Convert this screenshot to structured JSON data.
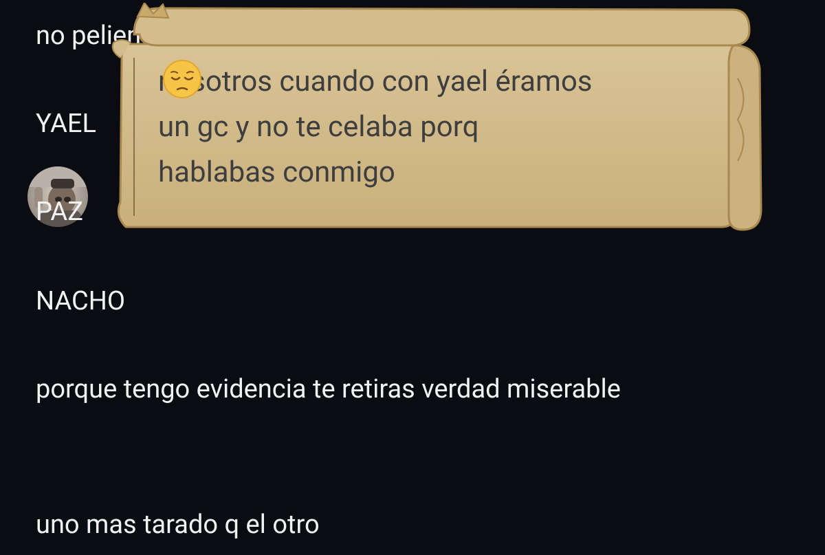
{
  "messages": [
    {
      "text": "no peliemos yael ok paces paz"
    },
    {
      "text": "YAEL"
    },
    {
      "text": "PAZ"
    },
    {
      "text": "NACHO"
    },
    {
      "text": "porque tengo evidencia te retiras verdad miserable"
    },
    {
      "text": "uno mas tarado q el otro"
    }
  ],
  "scroll_bubble": {
    "line1": "nosotros cuando con yael éramos",
    "line2": "un gc y no te celaba porq",
    "line3": "hablabas conmigo",
    "emoji_name": "pensive-face"
  },
  "colors": {
    "background": "#0a0c12",
    "text": "#f2f2f2",
    "scroll_fill": "#d2ba88",
    "scroll_edge": "#a8894f",
    "scroll_text": "#3e3e3e"
  }
}
